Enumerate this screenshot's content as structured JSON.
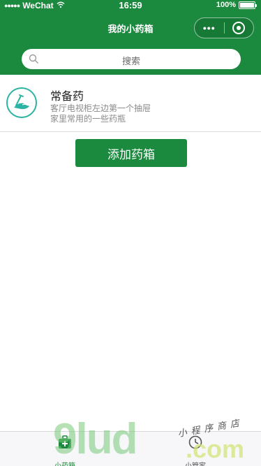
{
  "status_bar": {
    "carrier": "WeChat",
    "signal_dots": "●●●●●",
    "time": "16:59",
    "battery": "100%"
  },
  "nav": {
    "title": "我的小药箱",
    "more_label": "•••"
  },
  "search": {
    "placeholder": "搜索"
  },
  "medicine_boxes": [
    {
      "name": "常备药",
      "location": "客厅电视柜左边第一个抽屉",
      "description": "家里常用的一些药瓶"
    }
  ],
  "actions": {
    "add_box": "添加药箱"
  },
  "tabbar": {
    "tabs": [
      {
        "label": "小药箱",
        "icon": "medicine-kit-icon",
        "active": true
      },
      {
        "label": "小管家",
        "icon": "clock-icon",
        "active": false
      }
    ]
  },
  "watermark": {
    "main": "9lud",
    "com": ".com",
    "cn": "小程序商店"
  },
  "colors": {
    "brand_green": "#1b8a3e",
    "background": "#ffffff",
    "tabbar_bg": "#f7f7fa",
    "muted_text": "#8a8a8a"
  }
}
